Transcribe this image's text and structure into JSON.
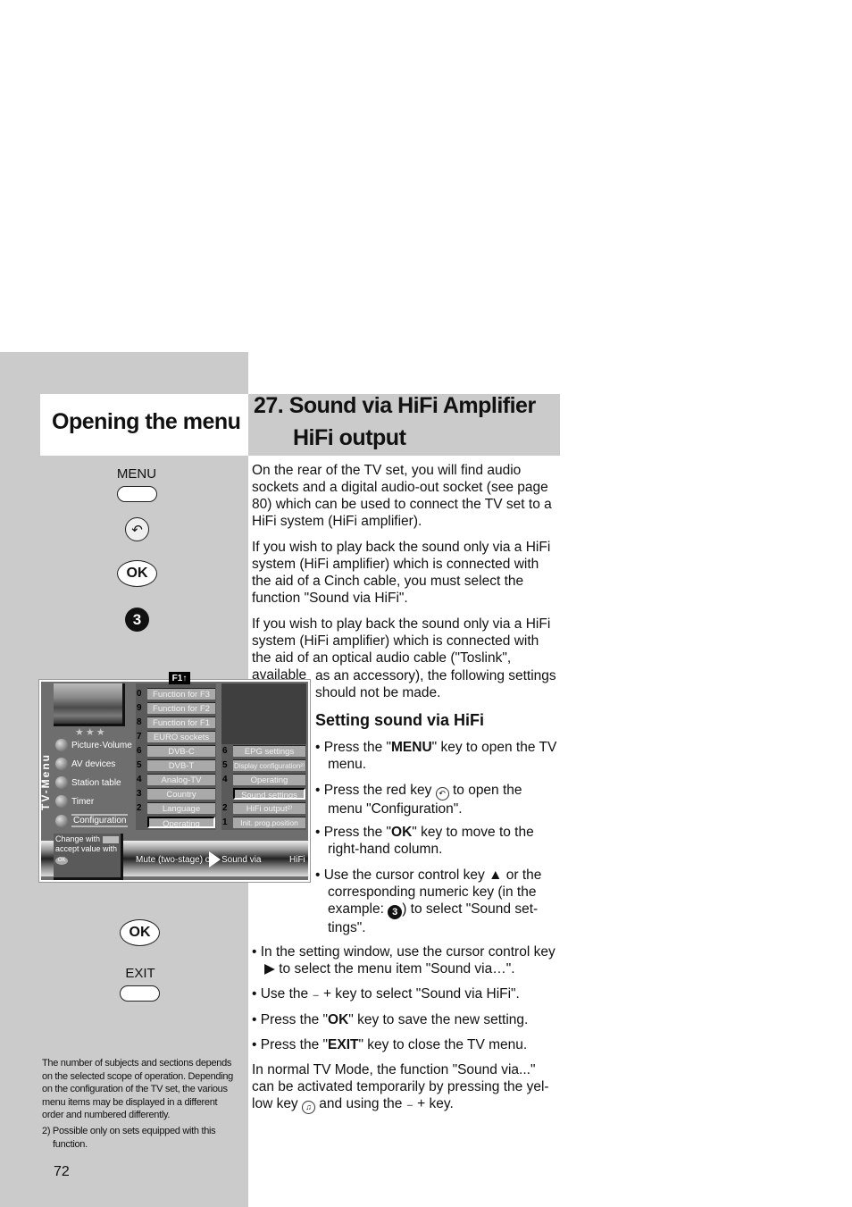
{
  "left_column": {
    "title": "Opening the menu",
    "keys": {
      "menu_label": "MENU",
      "red_key_icon": "return-arrow-icon",
      "ok_label": "OK",
      "num_label": "3",
      "ok2_label": "OK",
      "exit_label": "EXIT"
    },
    "footnote_main": "The number of subjects and sections depends on the selected scope of operation. Depending on the configuration of the TV set, the various menu items may be displayed in a different order and numbered differently.",
    "footnote_2": "2) Possible only on sets equipped with this function.",
    "page_number": "72"
  },
  "tv_menu": {
    "f1_badge": "F1↑",
    "vertical_title": "TV-Menu",
    "stars": "★★★",
    "nav": [
      {
        "label": "Picture·Volume"
      },
      {
        "label": "AV devices"
      },
      {
        "label": "Station table"
      },
      {
        "label": "Timer"
      },
      {
        "label": "Configuration",
        "selected": true
      }
    ],
    "col1": [
      {
        "num": "0",
        "label": "Function for F3"
      },
      {
        "num": "9",
        "label": "Function for F2"
      },
      {
        "num": "8",
        "label": "Function for F1"
      },
      {
        "num": "7",
        "label": "EURO sockets"
      },
      {
        "num": "6",
        "label": "DVB-C"
      },
      {
        "num": "5",
        "label": "DVB-T"
      },
      {
        "num": "4",
        "label": "Analog-TV"
      },
      {
        "num": "3",
        "label": "Country"
      },
      {
        "num": "2",
        "label": "Language"
      },
      {
        "num": "",
        "label": "Operating",
        "selected": true
      }
    ],
    "col2": [
      {
        "num": "6",
        "label": "EPG settings"
      },
      {
        "num": "5",
        "label": "Display configuration²⁾"
      },
      {
        "num": "4",
        "label": "Operating"
      },
      {
        "num": "",
        "label": "Sound settings",
        "selected": true
      },
      {
        "num": "2",
        "label": "HiFi output²⁾"
      },
      {
        "num": "1",
        "label": "Init. prog.position"
      }
    ],
    "info_line1": "Change with",
    "info_line2": "accept value with",
    "info_ok": "OK",
    "bar_left": "Mute (two-stage) of",
    "bar_mid": "Sound via",
    "bar_right": "HiFi"
  },
  "header": {
    "line1": "27. Sound via HiFi Amplifier",
    "line2": "HiFi output"
  },
  "body": {
    "para1": "On the rear of the TV set, you will find audio sockets and a digital audio-out socket (see page 80) which can be used to connect the TV set to a HiFi system (HiFi amplifier).",
    "para2": "If you wish to play back the sound only via a HiFi system (HiFi amplifier) which is connected with the aid of a Cinch cable, you must select the function \"Sound via HiFi\".",
    "para3a": "If you wish to play back the sound only via a HiFi system (HiFi amplifier) which is connected with the aid of an optical audio cable (\"Toslink\", available",
    "para3b": "as an accessory), the following settings should not be made.",
    "subheading": "Setting sound via HiFi",
    "bullets": {
      "b1_pre": "• Press the \"",
      "b1_key": "MENU",
      "b1_post": "\" key to open the TV menu.",
      "b2_pre": "• Press the red key ",
      "b2_icon": "↶",
      "b2_post": " to open the menu \"Configuration\".",
      "b3_pre": "• Press the \"",
      "b3_key": "OK",
      "b3_post": "\" key to move to the right-hand column.",
      "b4_pre": "• Use the cursor control key ▲ or the corresponding numeric key (in the example: ",
      "b4_num": "3",
      "b4_post": ") to select \"Sound set-tings\".",
      "b5": "• In the setting window, use the cursor control key ▶ to select the menu item \"Sound via…\".",
      "b6": "• Use the ₋ + key to select \"Sound via HiFi\".",
      "b7_pre": "• Press the \"",
      "b7_key": "OK",
      "b7_post": "\" key to save the new setting.",
      "b8_pre": "• Press the \"",
      "b8_key": "EXIT",
      "b8_post": "\" key to close the TV menu."
    },
    "final_pre": "In normal TV Mode, the function \"Sound via...\" can be activated temporarily by pressing the yel-low key ",
    "final_icon": "♫",
    "final_post": " and using the ₋ + key."
  }
}
